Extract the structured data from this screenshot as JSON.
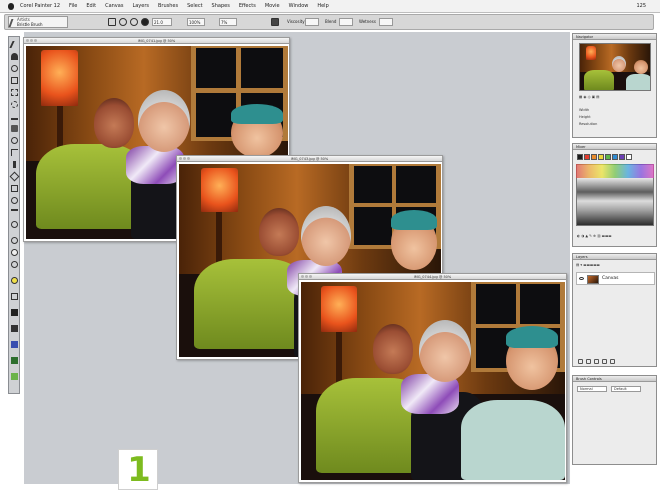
{
  "menubar": {
    "app_name": "Corel Painter 12",
    "items": [
      "File",
      "Edit",
      "Canvas",
      "Layers",
      "Brushes",
      "Select",
      "Shapes",
      "Effects",
      "Movie",
      "Window",
      "Help"
    ],
    "right_text": "125"
  },
  "property_bar": {
    "brush_category": "Artists",
    "brush_variant": "Bristle Brush",
    "size_value": "21.0",
    "opacity_value": "100%",
    "grain_value": "7%",
    "viscosity_label": "Viscosity",
    "blend_label": "Blend",
    "wetness_label": "Wetness"
  },
  "documents": [
    {
      "title": "IMG_0741.jpg @ 50%"
    },
    {
      "title": "IMG_0743.jpg @ 50%"
    },
    {
      "title": "IMG_0744.jpg @ 50%"
    }
  ],
  "palettes": {
    "navigator": {
      "title": "Navigator",
      "info_rows": [
        "Width",
        "Height",
        "Resolution"
      ]
    },
    "mixer": {
      "title": "Mixer"
    },
    "layers": {
      "title": "Layers",
      "layer_name": "Canvas"
    },
    "bottom": {
      "title": "Brush Controls",
      "row1": "Normal",
      "row2": "Default"
    }
  },
  "step_number": "1",
  "colors": {
    "workspace": "#c9ccd1",
    "step_number": "#7dbb1f",
    "lamp": "#e9531c",
    "sweater": "#a7c13a",
    "headband": "#2e8f8f"
  }
}
